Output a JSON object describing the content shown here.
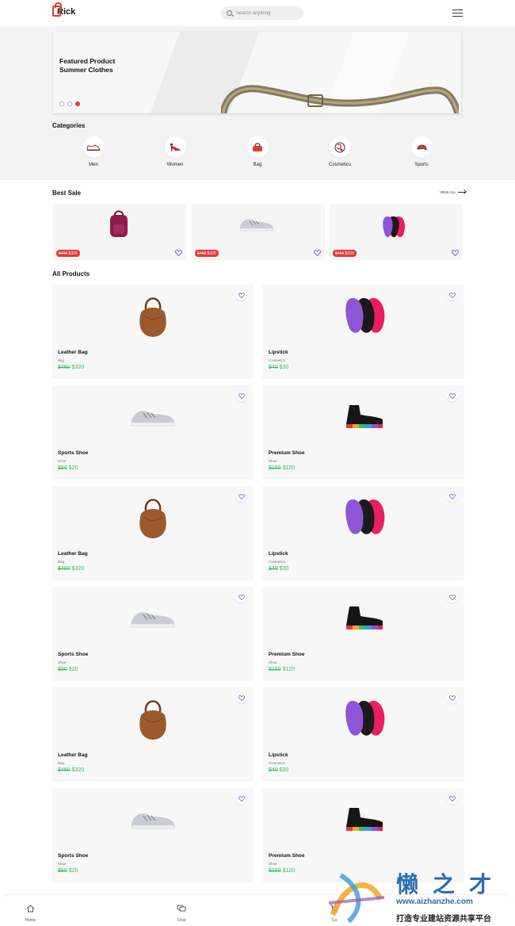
{
  "header": {
    "logo_text": "Rick",
    "search_placeholder": "Search anything"
  },
  "banner": {
    "title_line1": "Featured Product",
    "title_line2": "Summer Clothes",
    "active_slide": 3,
    "slide_count": 3
  },
  "categories": {
    "title": "Categories",
    "items": [
      {
        "label": "Men",
        "icon": "sneaker-icon"
      },
      {
        "label": "Women",
        "icon": "high-heel-icon"
      },
      {
        "label": "Bag",
        "icon": "handbag-icon"
      },
      {
        "label": "Cosmetics",
        "icon": "cosmetics-icon"
      },
      {
        "label": "Sports",
        "icon": "cap-icon"
      }
    ]
  },
  "best_sale": {
    "title": "Best Sale",
    "view_all": "VIEW ALL",
    "items": [
      {
        "old_price": "$460",
        "new_price": "$320",
        "image": "backpack-image"
      },
      {
        "old_price": "$460",
        "new_price": "$320",
        "image": "sneaker-image"
      },
      {
        "old_price": "$460",
        "new_price": "$320",
        "image": "lipstick-sponges-image"
      }
    ]
  },
  "all_products": {
    "title": "All Products",
    "items": [
      {
        "name": "Leather Bag",
        "category": "Bag",
        "old_price": "$460",
        "new_price": "$320",
        "image": "leather-bag-image"
      },
      {
        "name": "Lipstick",
        "category": "Cosmetics",
        "old_price": "$40",
        "new_price": "$30",
        "image": "lipstick-sponges-image"
      },
      {
        "name": "Sports Shoe",
        "category": "Shoe",
        "old_price": "$50",
        "new_price": "$20",
        "image": "sneaker-image"
      },
      {
        "name": "Premium Shoe",
        "category": "Shoe",
        "old_price": "$150",
        "new_price": "$120",
        "image": "sock-shoe-image"
      },
      {
        "name": "Leather Bag",
        "category": "Bag",
        "old_price": "$460",
        "new_price": "$320",
        "image": "leather-bag-image"
      },
      {
        "name": "Lipstick",
        "category": "Cosmetics",
        "old_price": "$40",
        "new_price": "$30",
        "image": "lipstick-sponges-image"
      },
      {
        "name": "Sports Shoe",
        "category": "Shoe",
        "old_price": "$50",
        "new_price": "$20",
        "image": "sneaker-image"
      },
      {
        "name": "Premium Shoe",
        "category": "Shoe",
        "old_price": "$150",
        "new_price": "$120",
        "image": "sock-shoe-image"
      },
      {
        "name": "Leather Bag",
        "category": "Bag",
        "old_price": "$460",
        "new_price": "$320",
        "image": "leather-bag-image"
      },
      {
        "name": "Lipstick",
        "category": "Cosmetics",
        "old_price": "$40",
        "new_price": "$30",
        "image": "lipstick-sponges-image"
      },
      {
        "name": "Sports Shoe",
        "category": "Shoe",
        "old_price": "$50",
        "new_price": "$20",
        "image": "sneaker-image"
      },
      {
        "name": "Premium Shoe",
        "category": "Shoe",
        "old_price": "$150",
        "new_price": "$120",
        "image": "sock-shoe-image"
      }
    ]
  },
  "bottom_nav": {
    "items": [
      {
        "label": "Home",
        "icon": "home-icon"
      },
      {
        "label": "Chat",
        "icon": "chat-icon"
      },
      {
        "label": "Ca",
        "icon": "cart-icon"
      }
    ]
  },
  "watermark": {
    "title": "懒之才",
    "url": "www.aizhanzhe.com",
    "subtitle": "打造专业建站资源共享平台"
  },
  "colors": {
    "accent": "#e53935",
    "price_green": "#2ebf6a",
    "heart_purple": "#6b5fd3"
  }
}
